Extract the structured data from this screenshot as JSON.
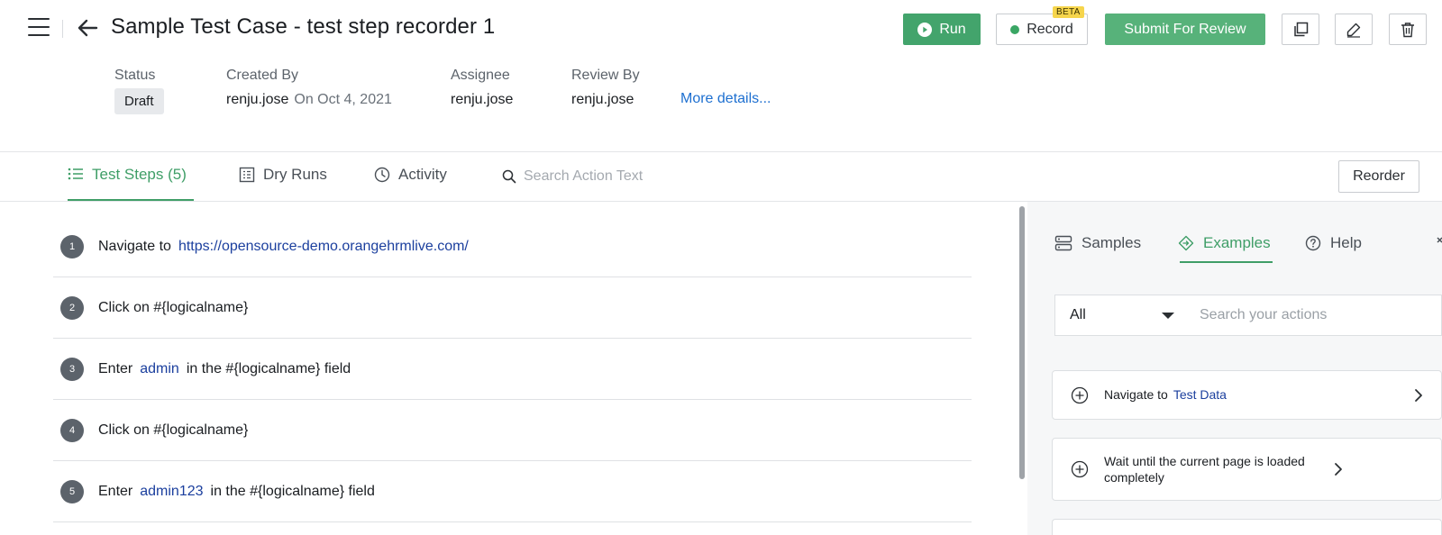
{
  "header": {
    "title": "Sample Test Case - test step recorder 1",
    "run_label": "Run",
    "record_label": "Record",
    "beta_badge": "BETA",
    "submit_label": "Submit For Review"
  },
  "meta": {
    "status_label": "Status",
    "status_value": "Draft",
    "created_by_label": "Created By",
    "created_by_value": "renju.jose",
    "created_on": "On Oct 4, 2021",
    "assignee_label": "Assignee",
    "assignee_value": "renju.jose",
    "review_by_label": "Review By",
    "review_by_value": "renju.jose",
    "more_details": "More details..."
  },
  "tabs": {
    "steps": "Test Steps (5)",
    "dry_runs": "Dry Runs",
    "activity": "Activity",
    "search_placeholder": "Search Action Text",
    "reorder": "Reorder"
  },
  "steps": [
    {
      "num": "1",
      "before": "Navigate to",
      "highlight": "https://opensource-demo.orangehrmlive.com/",
      "after": ""
    },
    {
      "num": "2",
      "before": "Click on #{logicalname}",
      "highlight": "",
      "after": ""
    },
    {
      "num": "3",
      "before": "Enter",
      "highlight": "admin",
      "after": "in the #{logicalname} field"
    },
    {
      "num": "4",
      "before": "Click on #{logicalname}",
      "highlight": "",
      "after": ""
    },
    {
      "num": "5",
      "before": "Enter",
      "highlight": "admin123",
      "after": "in the #{logicalname} field"
    }
  ],
  "panel": {
    "tab_samples": "Samples",
    "tab_examples": "Examples",
    "tab_help": "Help",
    "filter_value": "All",
    "search_placeholder": "Search your actions",
    "cards": [
      {
        "text": "Navigate to",
        "highlight": "Test Data"
      },
      {
        "text": "Wait until the current page is loaded completely",
        "highlight": ""
      }
    ]
  },
  "colors": {
    "accent_green": "#43a46c",
    "link_blue": "#1d6fd0",
    "data_blue": "#1b3f9e",
    "beta_yellow": "#f6d54c"
  },
  "icons": [
    "hamburger-icon",
    "back-arrow-icon",
    "play-icon",
    "record-dot-icon",
    "copy-icon",
    "pencil-icon",
    "trash-icon",
    "list-icon",
    "dry-runs-icon",
    "clock-icon",
    "search-icon",
    "samples-icon",
    "examples-icon",
    "help-icon",
    "close-icon",
    "plus-circle-icon",
    "chevron-right-icon"
  ]
}
